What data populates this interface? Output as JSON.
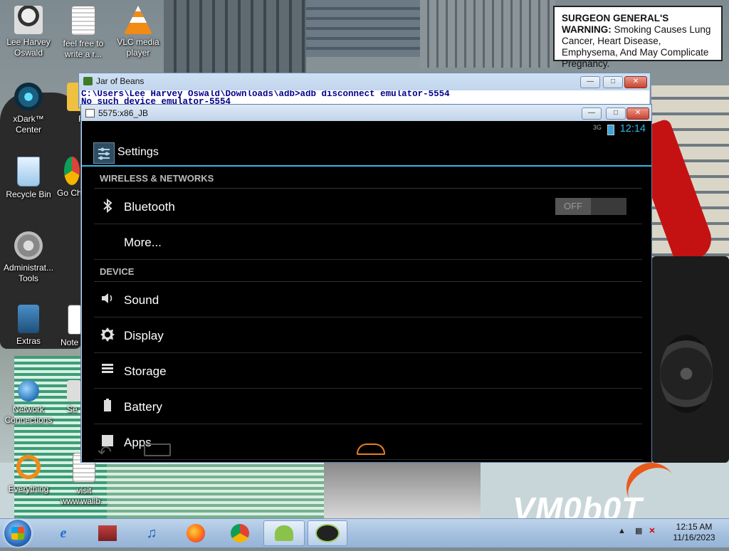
{
  "warning": {
    "head": "SURGEON GENERAL'S WARNING:",
    "text": "Smoking Causes Lung Cancer, Heart Disease, Emphysema, And May Complicate Pregnancy."
  },
  "desktop_icons": [
    {
      "label": "Lee Harvey Oswald"
    },
    {
      "label": "feel free to write a r..."
    },
    {
      "label": "VLC media player"
    },
    {
      "label": "xDark™ Center"
    },
    {
      "label": "Fi"
    },
    {
      "label": "Recycle Bin"
    },
    {
      "label": "Go Ch"
    },
    {
      "label": "Administrat... Tools"
    },
    {
      "label": "Extras"
    },
    {
      "label": "Note"
    },
    {
      "label": "Network Connections"
    },
    {
      "label": "Se"
    },
    {
      "label": "Everything"
    },
    {
      "label": "visit www.wallb..."
    }
  ],
  "watermark": "VM0b0T",
  "console": {
    "title": "Jar of Beans",
    "line1": "C:\\Users\\Lee Harvey Oswald\\Downloads\\adb>adb disconnect emulator-5554",
    "line2": "No such device emulator-5554"
  },
  "emulator": {
    "title": "5575:x86_JB",
    "status": {
      "signal": "3G",
      "time": "12:14"
    },
    "actionbar_title": "Settings",
    "sections": [
      {
        "header": "WIRELESS & NETWORKS",
        "items": [
          {
            "label": "Bluetooth",
            "icon": "bluetooth-icon",
            "toggle": "OFF"
          },
          {
            "label": "More...",
            "icon": ""
          }
        ]
      },
      {
        "header": "DEVICE",
        "items": [
          {
            "label": "Sound",
            "icon": "speaker-icon"
          },
          {
            "label": "Display",
            "icon": "brightness-icon"
          },
          {
            "label": "Storage",
            "icon": "storage-icon"
          },
          {
            "label": "Battery",
            "icon": "battery-icon"
          },
          {
            "label": "Apps",
            "icon": "apps-icon"
          }
        ]
      }
    ]
  },
  "taskbar": {
    "clock_time": "12:15 AM",
    "clock_date": "11/16/2023"
  }
}
